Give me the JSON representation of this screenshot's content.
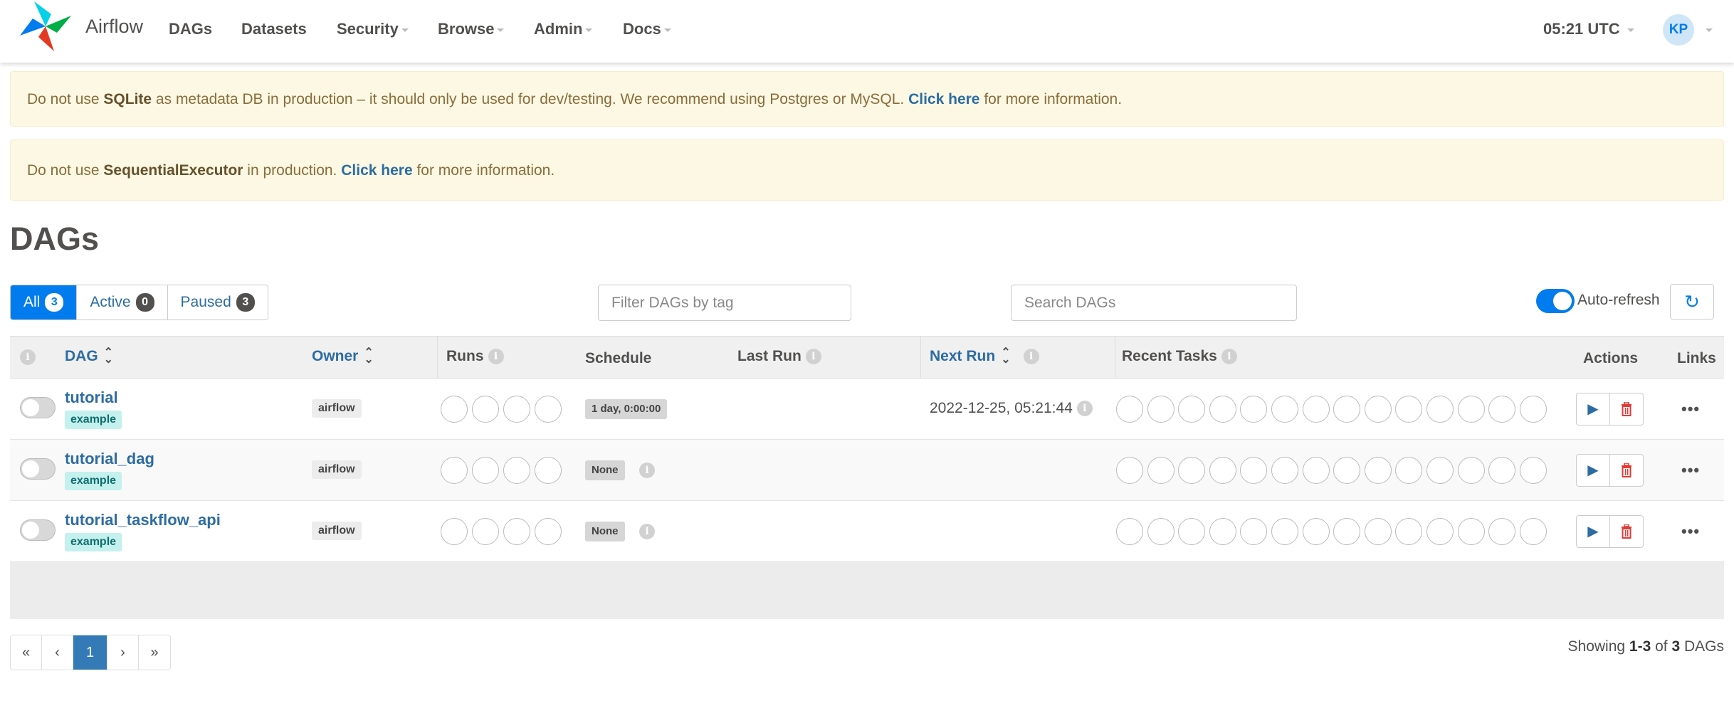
{
  "app": {
    "name": "Airflow",
    "brand_colors": {
      "blue": "#017cee",
      "red": "#e43921",
      "green": "#00ad46",
      "teal": "#04d1e8"
    }
  },
  "nav": {
    "items": [
      {
        "label": "DAGs",
        "dropdown": false
      },
      {
        "label": "Datasets",
        "dropdown": false
      },
      {
        "label": "Security",
        "dropdown": true
      },
      {
        "label": "Browse",
        "dropdown": true
      },
      {
        "label": "Admin",
        "dropdown": true
      },
      {
        "label": "Docs",
        "dropdown": true
      }
    ],
    "time": "05:21 UTC",
    "user_initials": "KP"
  },
  "alerts": [
    {
      "pre": "Do not use ",
      "bold": "SQLite",
      "mid": " as metadata DB in production – it should only be used for dev/testing. We recommend using Postgres or MySQL. ",
      "link": "Click here",
      "post": " for more information."
    },
    {
      "pre": "Do not use ",
      "bold": "SequentialExecutor",
      "mid": " in production. ",
      "link": "Click here",
      "post": " for more information."
    }
  ],
  "page_title": "DAGs",
  "filters": {
    "status": [
      {
        "label": "All",
        "count": "3",
        "active": true
      },
      {
        "label": "Active",
        "count": "0",
        "active": false
      },
      {
        "label": "Paused",
        "count": "3",
        "active": false
      }
    ],
    "tag_placeholder": "Filter DAGs by tag",
    "search_placeholder": "Search DAGs",
    "auto_refresh_label": "Auto-refresh",
    "auto_refresh_on": true
  },
  "table": {
    "headers": {
      "dag": "DAG",
      "owner": "Owner",
      "runs": "Runs",
      "schedule": "Schedule",
      "last_run": "Last Run",
      "next_run": "Next Run",
      "recent_tasks": "Recent Tasks",
      "actions": "Actions",
      "links": "Links"
    },
    "rows": [
      {
        "dag_id": "tutorial",
        "tag": "example",
        "owner": "airflow",
        "schedule": "1 day, 0:00:00",
        "next_run": "2022-12-25, 05:21:44",
        "paused": true
      },
      {
        "dag_id": "tutorial_dag",
        "tag": "example",
        "owner": "airflow",
        "schedule": "None",
        "next_run": "",
        "paused": true
      },
      {
        "dag_id": "tutorial_taskflow_api",
        "tag": "example",
        "owner": "airflow",
        "schedule": "None",
        "next_run": "",
        "paused": true
      }
    ],
    "run_circles": 4,
    "task_circles": 14
  },
  "pagination": {
    "first": "«",
    "prev": "‹",
    "current": "1",
    "next": "›",
    "last": "»",
    "showing_pre": "Showing ",
    "showing_range": "1-3",
    "showing_mid": " of ",
    "showing_total": "3",
    "showing_post": " DAGs"
  }
}
